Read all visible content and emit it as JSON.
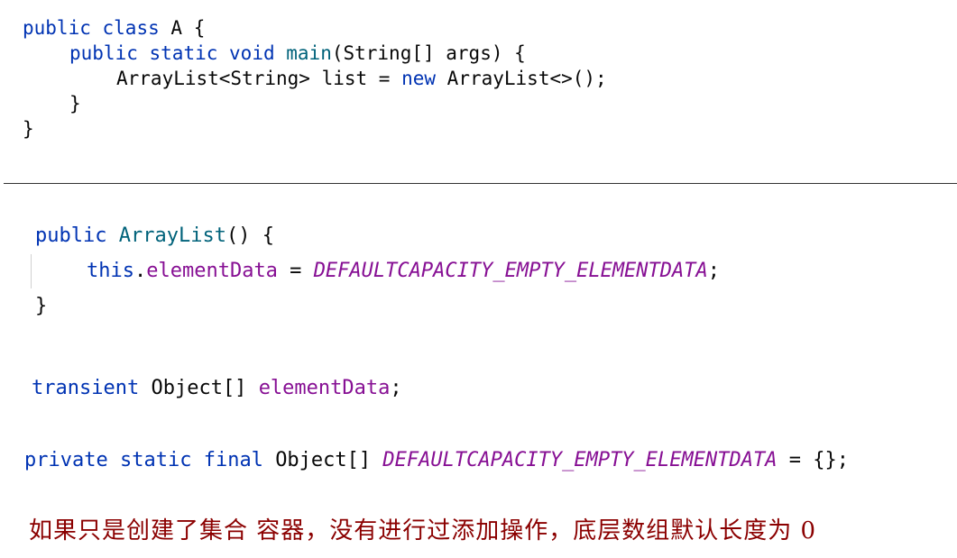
{
  "code_block_1": {
    "l1": {
      "kw1": "public",
      "kw2": "class",
      "name": "A",
      "brace": "{"
    },
    "l2": {
      "kw1": "public",
      "kw2": "static",
      "kw3": "void",
      "fn": "main",
      "rest": "(String[] args) {"
    },
    "l3": {
      "type": "ArrayList<String> list = ",
      "kw": "new",
      "rest": "ArrayList<>();"
    },
    "l4": "}",
    "l5": "}"
  },
  "code_block_2": {
    "l1": {
      "kw": "public",
      "fn": "ArrayList",
      "rest": "() {"
    },
    "l2": {
      "kw": "this",
      "dot": ".",
      "field": "elementData",
      "eq": " = ",
      "const": "DEFAULTCAPACITY_EMPTY_ELEMENTDATA",
      "semi": ";"
    },
    "l3": "}"
  },
  "code_block_3": {
    "kw": "transient",
    "type": "Object[]",
    "field": "elementData",
    "semi": ";"
  },
  "code_block_4": {
    "kw1": "private",
    "kw2": "static",
    "kw3": "final",
    "type": "Object[]",
    "const": "DEFAULTCAPACITY_EMPTY_ELEMENTDATA",
    "rest": " = {};"
  },
  "note": "如果只是创建了集合 容器，没有进行过添加操作，底层数组默认长度为 0",
  "colors": {
    "keyword": "#0033b3",
    "method": "#00627a",
    "field": "#871094",
    "note": "#8b0000"
  }
}
